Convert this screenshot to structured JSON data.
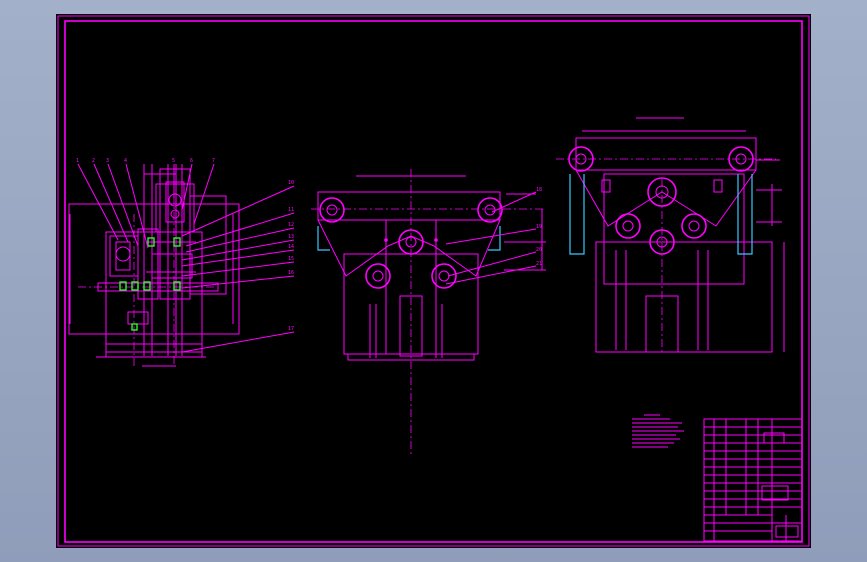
{
  "drawing": {
    "balloons": [
      "1",
      "2",
      "3",
      "4",
      "5",
      "6",
      "7",
      "8",
      "9",
      "10",
      "11",
      "12",
      "13",
      "14",
      "15",
      "16",
      "17",
      "18",
      "19",
      "20",
      "21"
    ],
    "colors": {
      "background": "#9ba9c4",
      "sheet": "#000000",
      "line": "#ff00ff",
      "highlight": "#22ff22",
      "accent": "#38c8ff"
    }
  }
}
